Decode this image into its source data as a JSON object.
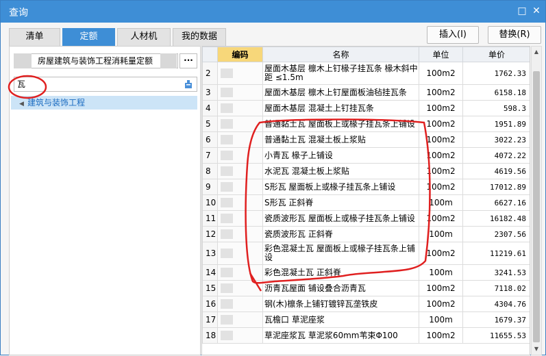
{
  "window": {
    "title": "查询",
    "minimize": "□",
    "close": "✕"
  },
  "tabs": [
    {
      "label": "清单",
      "active": false
    },
    {
      "label": "定额",
      "active": true
    },
    {
      "label": "人材机",
      "active": false
    },
    {
      "label": "我的数据",
      "active": false
    }
  ],
  "actions": {
    "insert": "插入(I)",
    "replace": "替换(R)"
  },
  "left": {
    "library": "房屋建筑与装饰工程消耗量定额",
    "library_more": "···",
    "search_value": "瓦",
    "tree_item": "建筑与装饰工程"
  },
  "grid": {
    "headers": {
      "code": "编码",
      "name": "名称",
      "unit": "单位",
      "price": "单价"
    },
    "rows": [
      {
        "idx": "2",
        "name": "屋面木基层 檩木上钉椽子挂瓦条 椽木斜中距 ≤1.5m",
        "unit": "100m2",
        "price": "1762.33",
        "tall": true
      },
      {
        "idx": "3",
        "name": "屋面木基层 檩木上钉屋面板油毡挂瓦条",
        "unit": "100m2",
        "price": "6158.18",
        "tall": false
      },
      {
        "idx": "4",
        "name": "屋面木基层 混凝土上钉挂瓦条",
        "unit": "100m2",
        "price": "598.3",
        "tall": false
      },
      {
        "idx": "5",
        "name": "普通黏土瓦 屋面板上或椽子挂瓦条上铺设",
        "unit": "100m2",
        "price": "1951.89",
        "tall": false
      },
      {
        "idx": "6",
        "name": "普通黏土瓦 混凝土板上浆贴",
        "unit": "100m2",
        "price": "3022.23",
        "tall": false
      },
      {
        "idx": "7",
        "name": "小青瓦 椽子上铺设",
        "unit": "100m2",
        "price": "4072.22",
        "tall": false
      },
      {
        "idx": "8",
        "name": "水泥瓦 混凝土板上浆贴",
        "unit": "100m2",
        "price": "4619.56",
        "tall": false
      },
      {
        "idx": "9",
        "name": "S形瓦 屋面板上或椽子挂瓦条上铺设",
        "unit": "100m2",
        "price": "17012.89",
        "tall": false
      },
      {
        "idx": "10",
        "name": "S形瓦 正斜脊",
        "unit": "100m",
        "price": "6627.16",
        "tall": false
      },
      {
        "idx": "11",
        "name": "瓷质波形瓦 屋面板上或椽子挂瓦条上铺设",
        "unit": "100m2",
        "price": "16182.48",
        "tall": false
      },
      {
        "idx": "12",
        "name": "瓷质波形瓦 正斜脊",
        "unit": "100m",
        "price": "2307.56",
        "tall": false
      },
      {
        "idx": "13",
        "name": "彩色混凝土瓦 屋面板上或椽子挂瓦条上铺设",
        "unit": "100m2",
        "price": "11219.61",
        "tall": true
      },
      {
        "idx": "14",
        "name": "彩色混凝土瓦 正斜脊",
        "unit": "100m",
        "price": "3241.53",
        "tall": false
      },
      {
        "idx": "15",
        "name": "沥青瓦屋面 铺设叠合沥青瓦",
        "unit": "100m2",
        "price": "7118.02",
        "tall": false
      },
      {
        "idx": "16",
        "name": "钢(木)檩条上铺钉镀锌瓦垄铁皮",
        "unit": "100m2",
        "price": "4304.76",
        "tall": false
      },
      {
        "idx": "17",
        "name": "瓦檐口 草泥座浆",
        "unit": "100m",
        "price": "1679.37",
        "tall": false
      },
      {
        "idx": "18",
        "name": "草泥座浆瓦 草泥浆60mm苇束Φ100",
        "unit": "100m2",
        "price": "11655.53",
        "tall": false
      }
    ]
  },
  "colors": {
    "title_bar": "#3e8ed6",
    "active_tab": "#3e8ed6",
    "code_header": "#f7d77a",
    "annotation": "#e02020",
    "selection": "#cce4f7"
  }
}
